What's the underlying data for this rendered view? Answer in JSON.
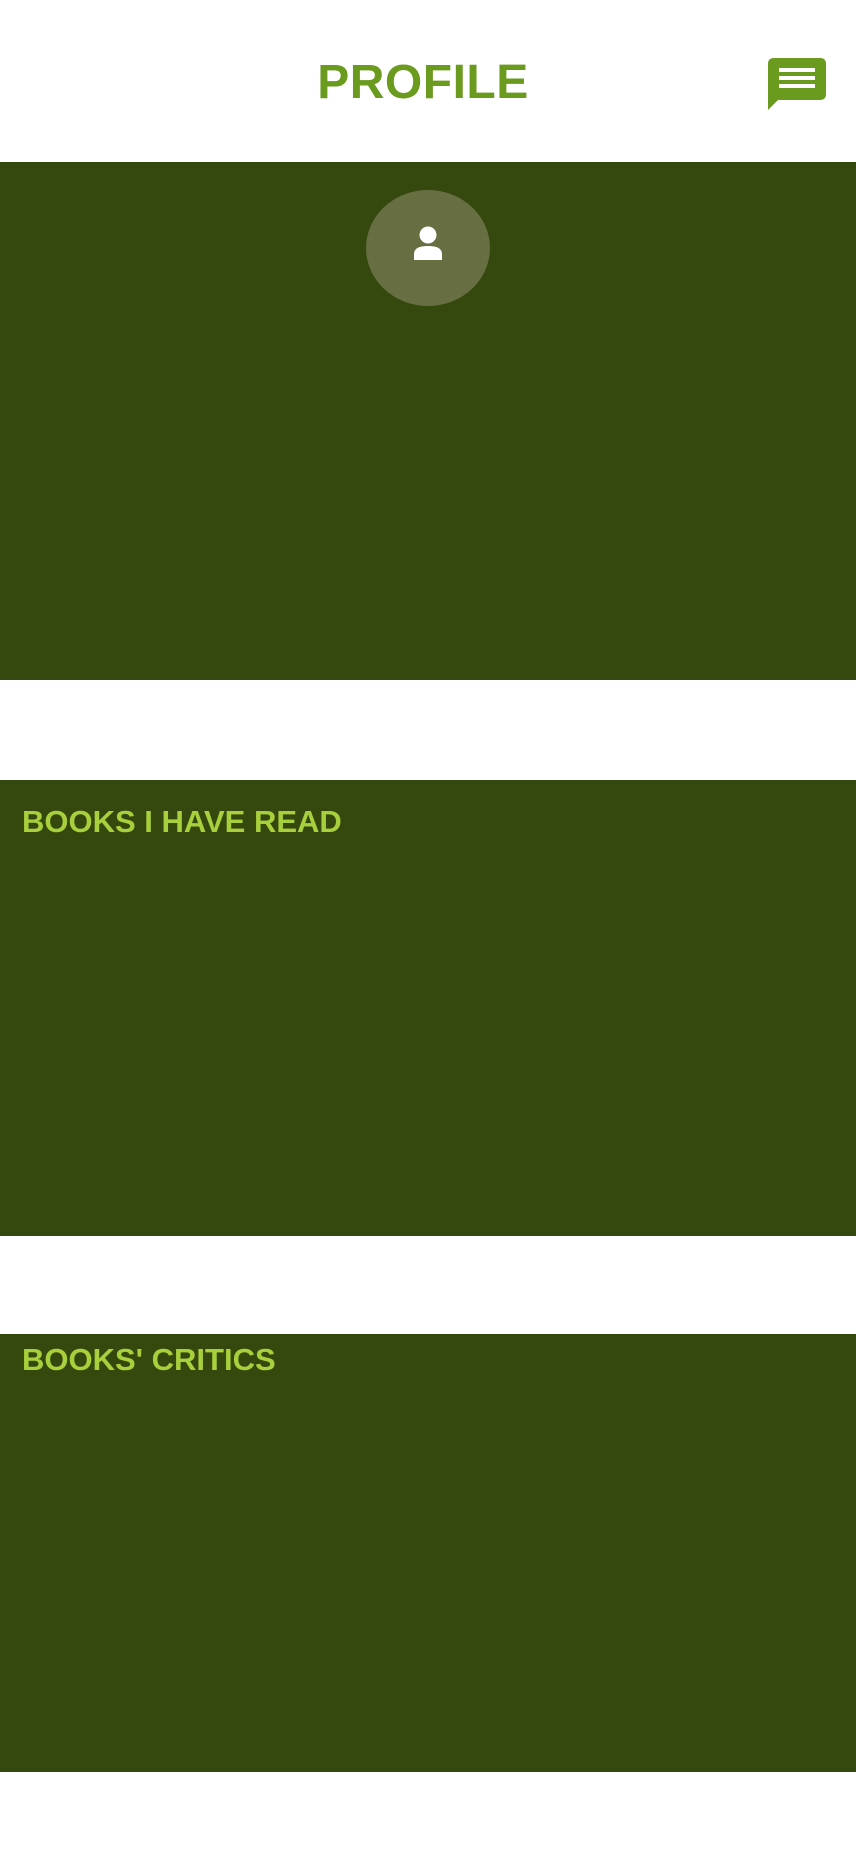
{
  "header": {
    "title": "PROFILE",
    "chat_button_icon": "chat-menu-icon"
  },
  "profile": {
    "avatar_icon": "user-icon"
  },
  "sections": {
    "books_read": {
      "title": "BOOKS I HAVE READ"
    },
    "books_critics": {
      "title": "BOOKS' CRITICS"
    }
  },
  "colors": {
    "brand_green": "#6a9a1e",
    "panel_dark_green": "#35490f",
    "section_title_lime": "#a8cf3c",
    "avatar_bg": "#666e42"
  }
}
